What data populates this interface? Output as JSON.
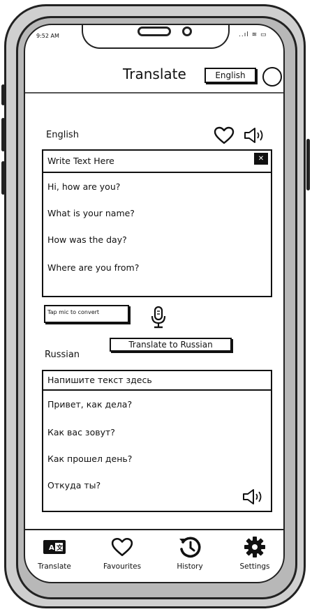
{
  "status_bar": {
    "time": "9:52 AM",
    "indicators": "..ıl ≋ ▭"
  },
  "header": {
    "title": "Translate",
    "language_button": "English"
  },
  "source": {
    "language_label": "English",
    "input_placeholder": "Write Text Here",
    "phrases": [
      "Hi, how are you?",
      "What is your name?",
      "How was the day?",
      "Where are you from?"
    ],
    "close_icon": "✕"
  },
  "mic_hint": "Tap mic to convert",
  "translate_button": "Translate to Russian",
  "target": {
    "language_label": "Russian",
    "output_placeholder": "Напишите текст здесь",
    "phrases": [
      "Привет, как дела?",
      "Как вас зовут?",
      "Как прошел день?",
      "Откуда ты?"
    ]
  },
  "nav": {
    "items": [
      {
        "label": "Translate",
        "icon": "translate-icon"
      },
      {
        "label": "Favourites",
        "icon": "heart-icon"
      },
      {
        "label": "History",
        "icon": "history-icon"
      },
      {
        "label": "Settings",
        "icon": "gear-icon"
      }
    ]
  }
}
